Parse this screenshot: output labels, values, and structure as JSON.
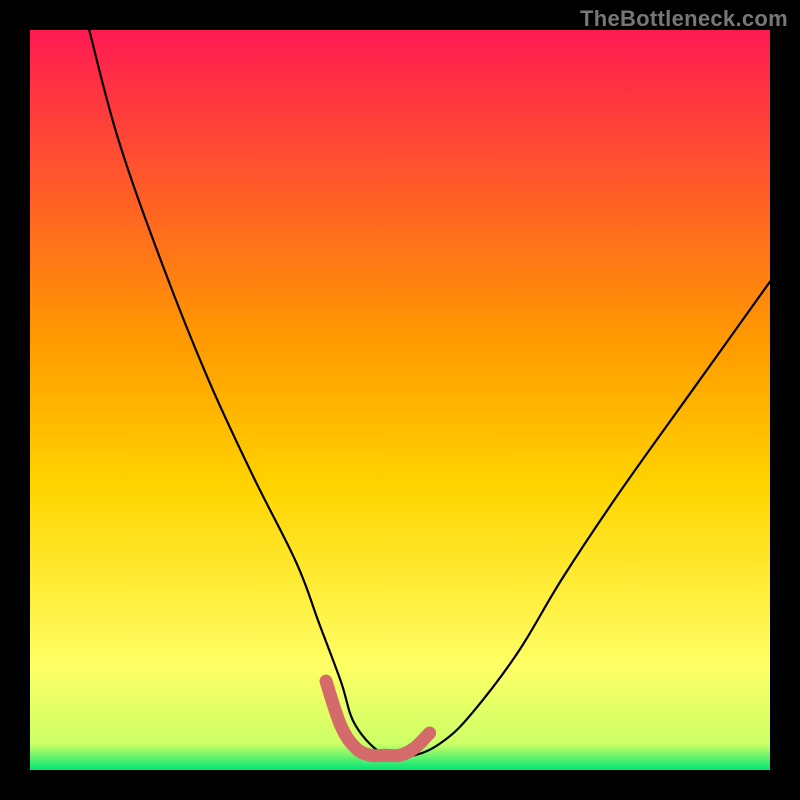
{
  "watermark": "TheBottleneck.com",
  "colors": {
    "page_bg": "#000000",
    "gradient_top": "#ff1a52",
    "gradient_mid": "#ffd500",
    "gradient_low": "#ffff66",
    "gradient_bottom": "#00e676",
    "curve": "#000000",
    "highlight": "#d46a6a"
  },
  "chart_data": {
    "type": "line",
    "title": "",
    "xlabel": "",
    "ylabel": "",
    "xlim": [
      0,
      100
    ],
    "ylim": [
      0,
      100
    ],
    "grid": false,
    "legend": false,
    "series": [
      {
        "name": "curve",
        "x": [
          8,
          12,
          18,
          24,
          30,
          36,
          39,
          42,
          44,
          48,
          52,
          56,
          60,
          66,
          72,
          80,
          90,
          100
        ],
        "y": [
          100,
          85,
          68,
          53,
          40,
          28,
          20,
          12,
          6,
          2,
          2,
          4,
          8,
          16,
          26,
          38,
          52,
          66
        ]
      },
      {
        "name": "highlight",
        "x": [
          40,
          42,
          44,
          46,
          48,
          50,
          52,
          54
        ],
        "y": [
          12,
          6,
          3,
          2,
          2,
          2,
          3,
          5
        ]
      }
    ]
  }
}
